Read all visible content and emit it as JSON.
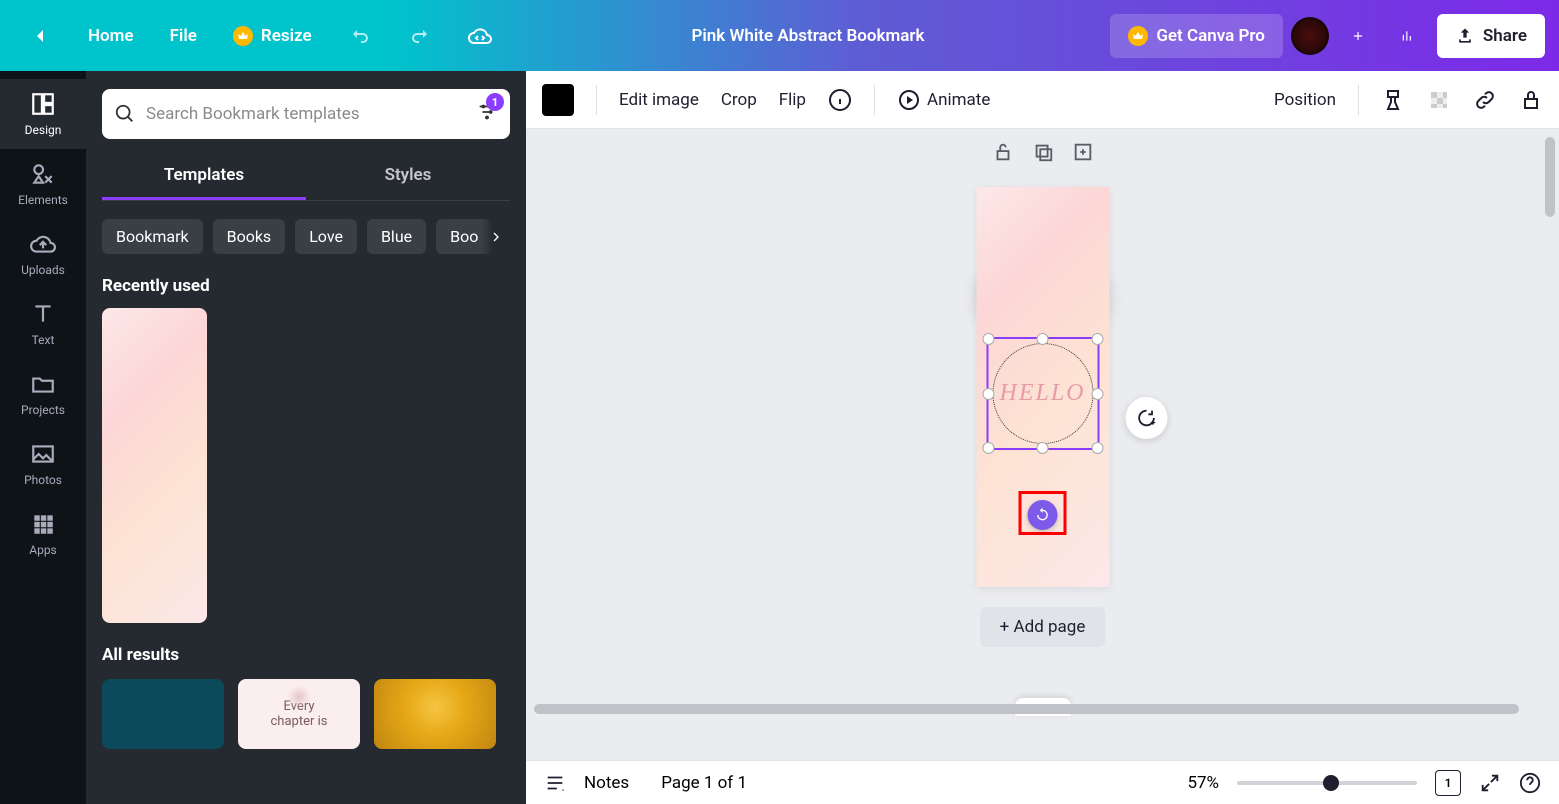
{
  "topbar": {
    "home": "Home",
    "file": "File",
    "resize": "Resize",
    "doc_title": "Pink White Abstract Bookmark",
    "get_pro": "Get Canva Pro",
    "share": "Share"
  },
  "rail": {
    "items": [
      {
        "label": "Design"
      },
      {
        "label": "Elements"
      },
      {
        "label": "Uploads"
      },
      {
        "label": "Text"
      },
      {
        "label": "Projects"
      },
      {
        "label": "Photos"
      },
      {
        "label": "Apps"
      }
    ]
  },
  "panel": {
    "search_placeholder": "Search Bookmark templates",
    "filter_badge": "1",
    "tabs": {
      "templates": "Templates",
      "styles": "Styles"
    },
    "chips": [
      "Bookmark",
      "Books",
      "Love",
      "Blue",
      "Boo"
    ],
    "recent_h": "Recently used",
    "all_results_h": "All results",
    "result2_line1": "Every",
    "result2_line2": "chapter is"
  },
  "ctx": {
    "edit_image": "Edit image",
    "crop": "Crop",
    "flip": "Flip",
    "animate": "Animate",
    "position": "Position"
  },
  "canvas": {
    "hello": "HELLO",
    "add_page": "+ Add page"
  },
  "bottom": {
    "notes": "Notes",
    "page_info": "Page 1 of 1",
    "zoom": "57%",
    "page_badge": "1"
  }
}
